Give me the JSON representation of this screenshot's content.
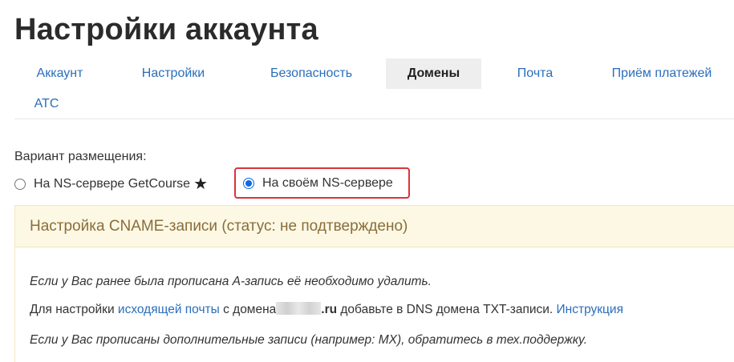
{
  "page": {
    "title": "Настройки аккаунта"
  },
  "tabs": [
    {
      "label": "Аккаунт",
      "active": false
    },
    {
      "label": "Настройки",
      "active": false
    },
    {
      "label": "Безопасность",
      "active": false
    },
    {
      "label": "Домены",
      "active": true
    },
    {
      "label": "Почта",
      "active": false
    },
    {
      "label": "Приём платежей",
      "active": false
    },
    {
      "label": "АТС",
      "active": false
    }
  ],
  "placement": {
    "label": "Вариант размещения:",
    "options": [
      {
        "label": "На NS-сервере GetCourse",
        "checked": false,
        "icon": "star-icon",
        "icon_glyph": "★"
      },
      {
        "label": "На своём NS-сервере",
        "checked": true
      }
    ],
    "highlight_color": "#d9343a"
  },
  "cname_panel": {
    "header": "Настройка CNAME-записи (статус: не подтверждено)",
    "note_a_record": "Если у Вас ранее была прописана A-запись её необходимо удалить.",
    "mail_note": {
      "prefix": "Для настройки ",
      "link_outgoing_mail": "исходящей почты",
      "middle": " с домена",
      "domain_suffix": ".ru",
      "after_domain": " добавьте в DNS домена TXT-записи. ",
      "link_instruction": "Инструкция"
    },
    "note_extra_records": "Если у Вас прописаны дополнительные записи (например: MX), обратитесь в тех.поддержку."
  },
  "colors": {
    "link": "#2a6ebb",
    "panel_header_bg": "#fcf8e3",
    "panel_header_text": "#8a6d3b",
    "active_tab_bg": "#eeeeee",
    "radio_checked": "#0b69e3"
  }
}
